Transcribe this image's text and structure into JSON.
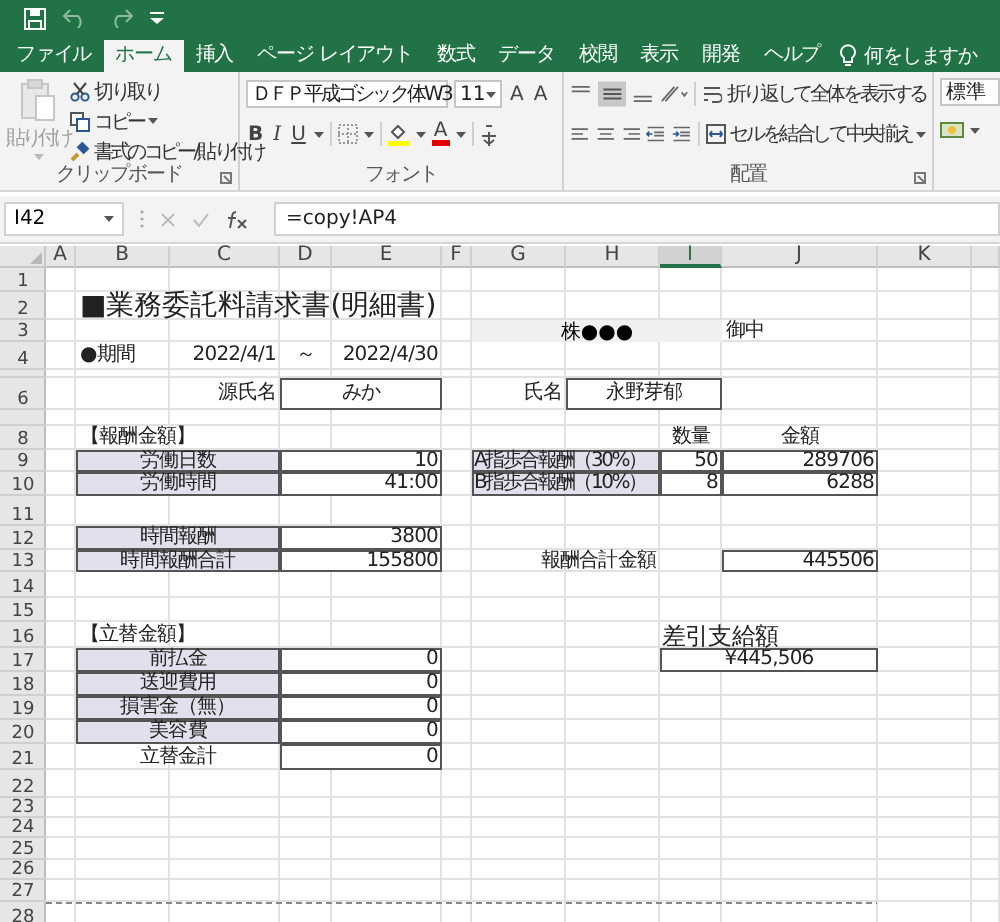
{
  "tabs": [
    {
      "label": "ファイル",
      "selected": false
    },
    {
      "label": "ホーム",
      "selected": true
    },
    {
      "label": "挿入",
      "selected": false
    },
    {
      "label": "ページ レイアウト",
      "selected": false
    },
    {
      "label": "数式",
      "selected": false
    },
    {
      "label": "データ",
      "selected": false
    },
    {
      "label": "校閲",
      "selected": false
    },
    {
      "label": "表示",
      "selected": false
    },
    {
      "label": "開発",
      "selected": false
    },
    {
      "label": "ヘルプ",
      "selected": false
    }
  ],
  "tell_me": "何をしますか",
  "ribbon": {
    "clipboard": {
      "paste": "貼り付け",
      "cut": "切り取り",
      "copy": "コピー",
      "format_painter": "書式のコピー/貼り付け",
      "label": "クリップボード"
    },
    "font": {
      "name": "ＤＦＰ平成ゴシック体W3",
      "size": "11",
      "grow": "A",
      "shrink": "A",
      "bold": "B",
      "italic": "I",
      "underline": "U",
      "font_color": "A",
      "label": "フォント"
    },
    "alignment": {
      "wrap": "折り返して全体を表示する",
      "merge": "セルを結合して中央揃え",
      "label": "配置"
    },
    "number": {
      "format": "標準"
    }
  },
  "formula_bar": {
    "name_box": "I42",
    "formula": "=copy!AP4"
  },
  "columns": [
    {
      "label": "A",
      "selected": false
    },
    {
      "label": "B",
      "selected": false
    },
    {
      "label": "C",
      "selected": false
    },
    {
      "label": "D",
      "selected": false
    },
    {
      "label": "E",
      "selected": false
    },
    {
      "label": "F",
      "selected": false
    },
    {
      "label": "G",
      "selected": false
    },
    {
      "label": "H",
      "selected": false
    },
    {
      "label": "I",
      "selected": true
    },
    {
      "label": "J",
      "selected": false
    },
    {
      "label": "K",
      "selected": false
    }
  ],
  "rows": [
    "1",
    "2",
    "3",
    "4",
    "6",
    "8",
    "9",
    "10",
    "11",
    "12",
    "13",
    "14",
    "15",
    "16",
    "17",
    "18",
    "19",
    "20",
    "21",
    "22",
    "23",
    "24",
    "25",
    "26",
    "27",
    "28"
  ],
  "sheet": {
    "title": "■業務委託料請求書(明細書)",
    "client": {
      "name": "株●●●",
      "suffix": "御中"
    },
    "period": {
      "label": "●期間",
      "start": "2022/4/1",
      "separator": "～",
      "end": "2022/4/30"
    },
    "source_name": {
      "label": "源氏名",
      "value": "みか"
    },
    "name": {
      "label": "氏名",
      "value": "永野芽郁"
    },
    "compensation": {
      "heading": "【報酬金額】",
      "rows": [
        {
          "label": "労働日数",
          "value": "10"
        },
        {
          "label": "労働時間",
          "value": "41:00"
        },
        {
          "label": "時間報酬",
          "value": "3800"
        },
        {
          "label": "時間報酬合計",
          "value": "155800"
        }
      ]
    },
    "commission": {
      "quantity_heading": "数量",
      "amount_heading": "金額",
      "rows": [
        {
          "label": "A指歩合報酬（30%）",
          "quantity": "50",
          "amount": "289706"
        },
        {
          "label": "B指歩合報酬（10%）",
          "quantity": "8",
          "amount": "6288"
        }
      ]
    },
    "total": {
      "label": "報酬合計金額",
      "value": "445506"
    },
    "advances": {
      "heading": "【立替金額】",
      "rows": [
        {
          "label": "前払金",
          "value": "0"
        },
        {
          "label": "送迎費用",
          "value": "0"
        },
        {
          "label": "損害金（無）",
          "value": "0"
        },
        {
          "label": "美容費",
          "value": "0"
        }
      ],
      "total": {
        "label": "立替金計",
        "value": "0"
      }
    },
    "net_pay": {
      "label": "差引支給額",
      "value": "¥445,506"
    }
  }
}
